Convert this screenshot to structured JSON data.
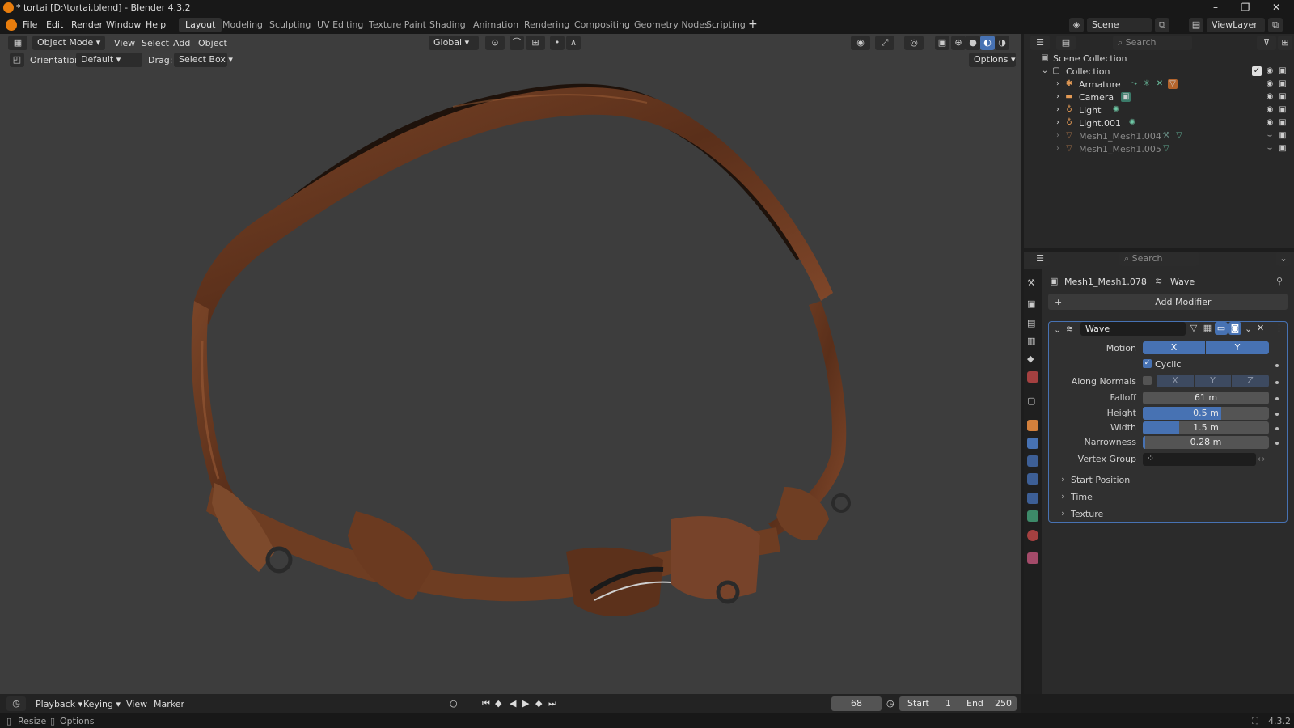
{
  "window": {
    "title": "* tortai [D:\\tortai.blend] - Blender 4.3.2",
    "controls": [
      "minimize",
      "maximize",
      "close"
    ]
  },
  "menu": [
    "File",
    "Edit",
    "Render",
    "Window",
    "Help"
  ],
  "workspaces": [
    "Layout",
    "Modeling",
    "Sculpting",
    "UV Editing",
    "Texture Paint",
    "Shading",
    "Animation",
    "Rendering",
    "Compositing",
    "Geometry Nodes",
    "Scripting"
  ],
  "active_workspace": "Layout",
  "scene": {
    "scene_name": "Scene",
    "view_layer": "ViewLayer"
  },
  "viewport_header": {
    "mode": "Object Mode",
    "menus": [
      "View",
      "Select",
      "Add",
      "Object"
    ],
    "transform_orientation": "Global"
  },
  "tool_settings": {
    "orientation_label": "Orientation:",
    "orientation_value": "Default",
    "drag_label": "Drag:",
    "drag_value": "Select Box",
    "options": "Options"
  },
  "outliner": {
    "search_placeholder": "Search",
    "root": "Scene Collection",
    "collection": "Collection",
    "items": [
      {
        "name": "Armature",
        "icon": "armature-icon",
        "visible": true
      },
      {
        "name": "Camera",
        "icon": "camera-icon",
        "visible": true
      },
      {
        "name": "Light",
        "icon": "light-icon",
        "visible": true
      },
      {
        "name": "Light.001",
        "icon": "light-icon",
        "visible": true
      },
      {
        "name": "Mesh1_Mesh1.004",
        "icon": "mesh-icon",
        "visible": false
      },
      {
        "name": "Mesh1_Mesh1.005",
        "icon": "mesh-icon",
        "visible": false
      }
    ]
  },
  "properties": {
    "search_placeholder": "Search",
    "breadcrumb_object": "Mesh1_Mesh1.078",
    "breadcrumb_modifier": "Wave",
    "add_modifier": "Add Modifier",
    "modifier": {
      "name": "Wave",
      "motion_label": "Motion",
      "motion_x": "X",
      "motion_y": "Y",
      "cyclic_label": "Cyclic",
      "cyclic_checked": true,
      "along_normals_label": "Along Normals",
      "along_normals_axes": [
        "X",
        "Y",
        "Z"
      ],
      "falloff_label": "Falloff",
      "falloff_value": "61 m",
      "height_label": "Height",
      "height_value": "0.5 m",
      "height_fill": 0.62,
      "width_label": "Width",
      "width_value": "1.5 m",
      "width_fill": 0.29,
      "narrowness_label": "Narrowness",
      "narrowness_value": "0.28 m",
      "narrowness_fill": 0.02,
      "vertex_group_label": "Vertex Group",
      "subpanels": [
        "Start Position",
        "Time",
        "Texture"
      ]
    }
  },
  "timeline": {
    "menus": [
      "Playback",
      "Keying",
      "View",
      "Marker"
    ],
    "current_frame": "68",
    "start_label": "Start",
    "start_value": "1",
    "end_label": "End",
    "end_value": "250"
  },
  "statusbar": {
    "left_items": [
      "Resize",
      "Options"
    ],
    "version": "4.3.2"
  },
  "colors": {
    "accent": "#4772b3",
    "viewport_bg": "#3d3d3d",
    "object_leather": "#6b3b22"
  }
}
